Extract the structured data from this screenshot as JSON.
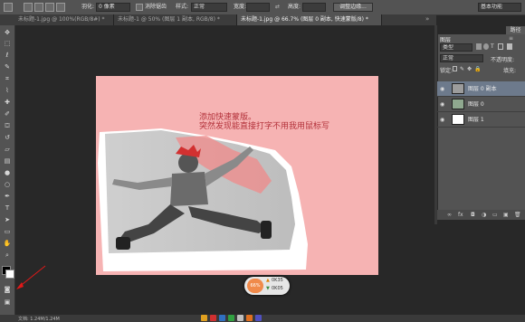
{
  "options_bar": {
    "feather_label": "羽化:",
    "feather_value": "0 像素",
    "antialias_label": "消除锯齿",
    "style_label": "样式:",
    "style_value": "正常",
    "width_label": "宽度:",
    "height_label": "高度:",
    "refine_edge_button": "调整边缘...",
    "workspace_value": "基本功能"
  },
  "tabs": [
    {
      "label": "未标题-1.jpg @ 100%(RGB/8#) *"
    },
    {
      "label": "未标题-1 @ 50% (图层 1 副本, RGB/8) *"
    },
    {
      "label": "未标题-1.jpg @ 66.7% (图层 0 副本, 快速蒙版/8) *"
    }
  ],
  "canvas": {
    "annotation_line1": "添加快速蒙版。",
    "annotation_line2": "突然发现能直接打字不用我用鼠标写"
  },
  "navigator": {
    "zoom": "66%",
    "value1": "0K35",
    "value2": "0K05"
  },
  "panel": {
    "title": "图层",
    "tab_paths": "路径",
    "kind_value": "类型",
    "blend_mode": "正常",
    "opacity_label": "不透明度:",
    "lock_label": "锁定:",
    "fill_label": "填充:",
    "layers": [
      {
        "name": "图层 0 副本"
      },
      {
        "name": "图层 0"
      },
      {
        "name": "图层 1"
      }
    ]
  },
  "status": {
    "text": "文档: 1.24M/1.24M"
  },
  "colors": {
    "canvas_pink": "#f6b3b3",
    "annotation_text": "#b3313a",
    "panel_gray": "#535353",
    "workspace": "#282828"
  }
}
